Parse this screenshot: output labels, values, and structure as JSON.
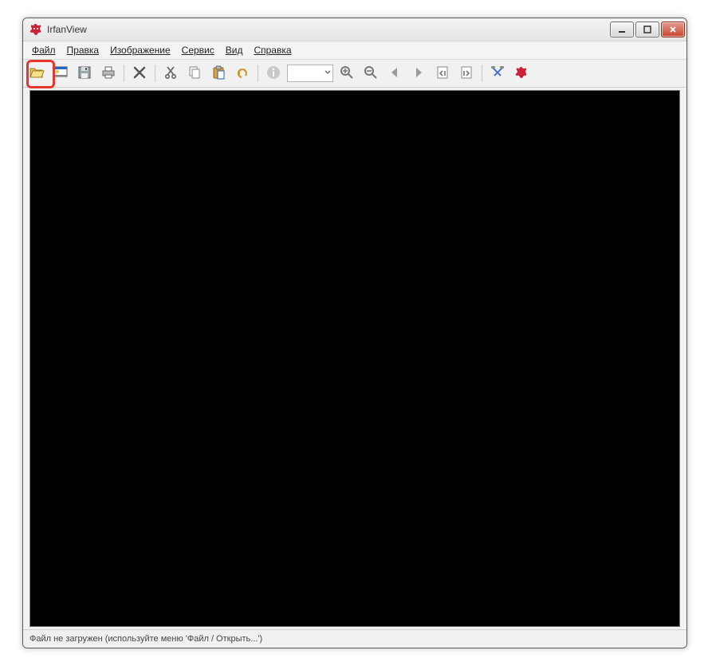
{
  "titlebar": {
    "title": "IrfanView"
  },
  "menu": {
    "file": "Файл",
    "edit": "Правка",
    "image": "Изображение",
    "service": "Сервис",
    "view": "Вид",
    "help": "Справка"
  },
  "toolbar": {
    "zoom_value": ""
  },
  "statusbar": {
    "message": "Файл не загружен (используйте меню 'Файл / Открыть...')"
  },
  "icons": {
    "open": "open-folder-icon",
    "slideshow": "slideshow-icon",
    "save": "save-icon",
    "print": "print-icon",
    "delete": "delete-icon",
    "cut": "cut-icon",
    "copy": "copy-icon",
    "paste": "paste-icon",
    "undo": "undo-icon",
    "info": "info-icon",
    "zoom_in": "zoom-in-icon",
    "zoom_out": "zoom-out-icon",
    "prev": "arrow-left-icon",
    "next": "arrow-right-icon",
    "first": "first-page-icon",
    "last": "last-page-icon",
    "settings": "settings-icon",
    "about": "cat-icon"
  }
}
